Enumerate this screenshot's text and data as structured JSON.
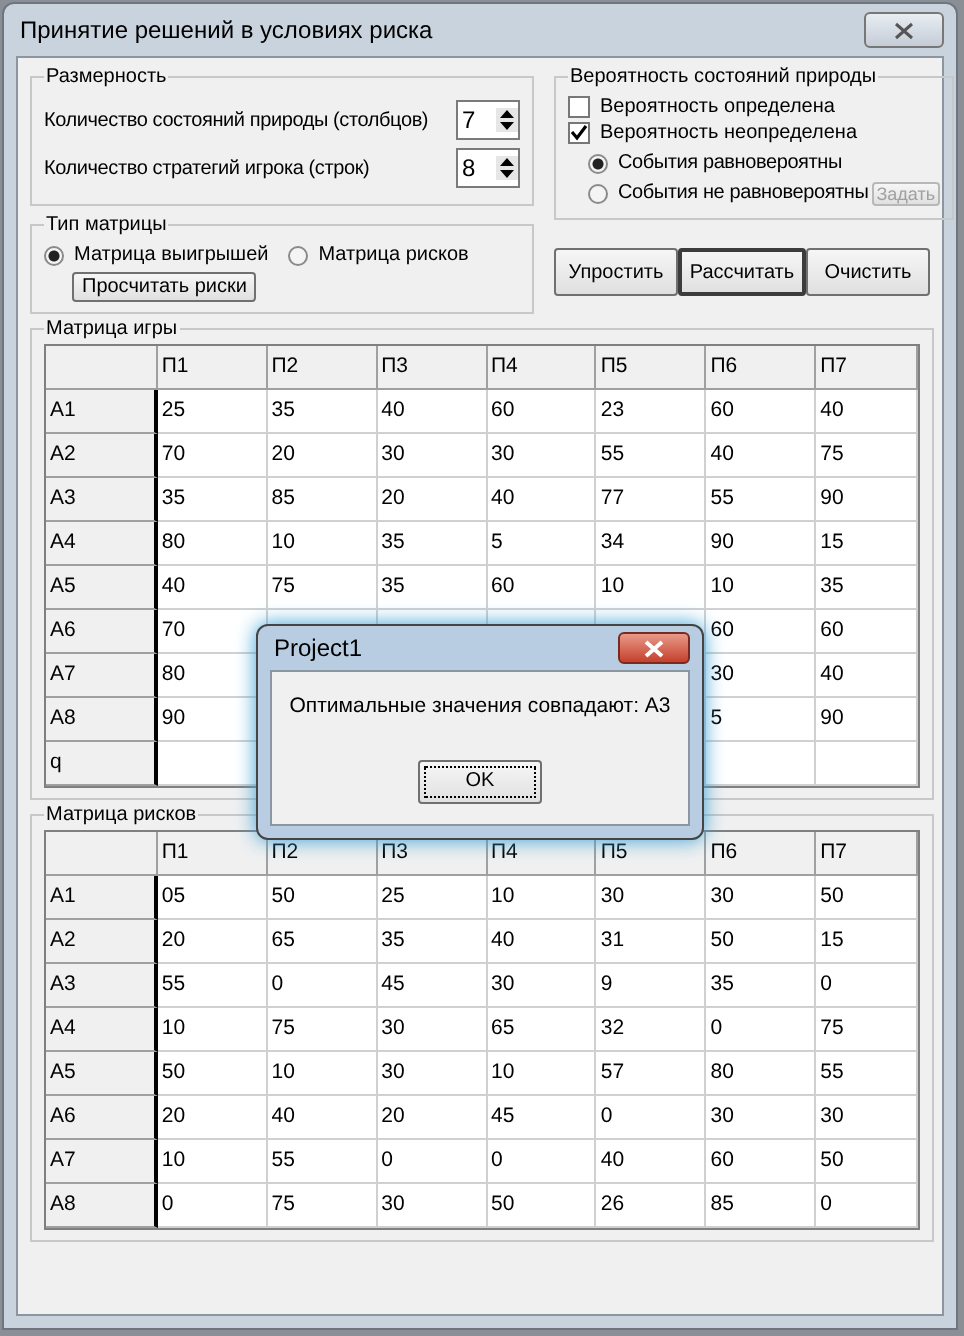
{
  "window": {
    "title": "Принятие решений в условиях риска"
  },
  "dimension": {
    "title": "Размерность",
    "fields": [
      {
        "label": "Количество состояний природы (столбцов)",
        "value": "7"
      },
      {
        "label": "Количество стратегий игрока (строк)",
        "value": "8"
      }
    ]
  },
  "probability": {
    "title": "Вероятность состояний природы",
    "checks": [
      {
        "label": "Вероятность определена",
        "checked": false
      },
      {
        "label": "Вероятность неопределена",
        "checked": true
      }
    ],
    "radios": [
      {
        "label": "События равновероятны",
        "selected": true
      },
      {
        "label": "События не равновероятны",
        "selected": false
      }
    ],
    "set_button": {
      "label": "Задать",
      "disabled": true
    }
  },
  "matrix_type": {
    "title": "Тип матрицы",
    "radios": [
      {
        "label": "Матрица выигрышей",
        "selected": true
      },
      {
        "label": "Матрица рисков",
        "selected": false
      }
    ],
    "button": "Просчитать риски"
  },
  "actions": [
    {
      "label": "Упростить",
      "default": false
    },
    {
      "label": "Рассчитать",
      "default": true
    },
    {
      "label": "Очистить",
      "default": false
    }
  ],
  "game_matrix": {
    "title": "Матрица игры",
    "columns": [
      "П1",
      "П2",
      "П3",
      "П4",
      "П5",
      "П6",
      "П7"
    ],
    "rows": [
      {
        "label": "A1",
        "cells": [
          "25",
          "35",
          "40",
          "60",
          "23",
          "60",
          "40"
        ]
      },
      {
        "label": "A2",
        "cells": [
          "70",
          "20",
          "30",
          "30",
          "55",
          "40",
          "75"
        ]
      },
      {
        "label": "A3",
        "cells": [
          "35",
          "85",
          "20",
          "40",
          "77",
          "55",
          "90"
        ]
      },
      {
        "label": "A4",
        "cells": [
          "80",
          "10",
          "35",
          "5",
          "34",
          "90",
          "15"
        ]
      },
      {
        "label": "A5",
        "cells": [
          "40",
          "75",
          "35",
          "60",
          "10",
          "10",
          "35"
        ]
      },
      {
        "label": "A6",
        "cells": [
          "70",
          null,
          null,
          null,
          null,
          "60",
          "60"
        ]
      },
      {
        "label": "A7",
        "cells": [
          "80",
          null,
          null,
          null,
          null,
          "30",
          "40"
        ]
      },
      {
        "label": "A8",
        "cells": [
          "90",
          null,
          null,
          null,
          null,
          "5",
          "90"
        ]
      },
      {
        "label": "q",
        "cells": []
      }
    ]
  },
  "risk_matrix": {
    "title": "Матрица рисков",
    "columns": [
      "П1",
      "П2",
      "П3",
      "П4",
      "П5",
      "П6",
      "П7"
    ],
    "rows": [
      {
        "label": "A1",
        "cells": [
          "05",
          "50",
          "25",
          "10",
          "30",
          "30",
          "50"
        ]
      },
      {
        "label": "A2",
        "cells": [
          "20",
          "65",
          "35",
          "40",
          "31",
          "50",
          "15"
        ]
      },
      {
        "label": "A3",
        "cells": [
          "55",
          "0",
          "45",
          "30",
          "9",
          "35",
          "0"
        ]
      },
      {
        "label": "A4",
        "cells": [
          "10",
          "75",
          "30",
          "65",
          "32",
          "0",
          "75"
        ]
      },
      {
        "label": "A5",
        "cells": [
          "50",
          "10",
          "30",
          "10",
          "57",
          "80",
          "55"
        ]
      },
      {
        "label": "A6",
        "cells": [
          "20",
          "40",
          "20",
          "45",
          "0",
          "30",
          "30"
        ]
      },
      {
        "label": "A7",
        "cells": [
          "10",
          "55",
          "0",
          "0",
          "40",
          "60",
          "50"
        ]
      },
      {
        "label": "A8",
        "cells": [
          "0",
          "75",
          "30",
          "50",
          "26",
          "85",
          "0"
        ]
      }
    ]
  },
  "dialog": {
    "title": "Project1",
    "message": "Оптимальные значения совпадают: A3",
    "button": "OK"
  }
}
